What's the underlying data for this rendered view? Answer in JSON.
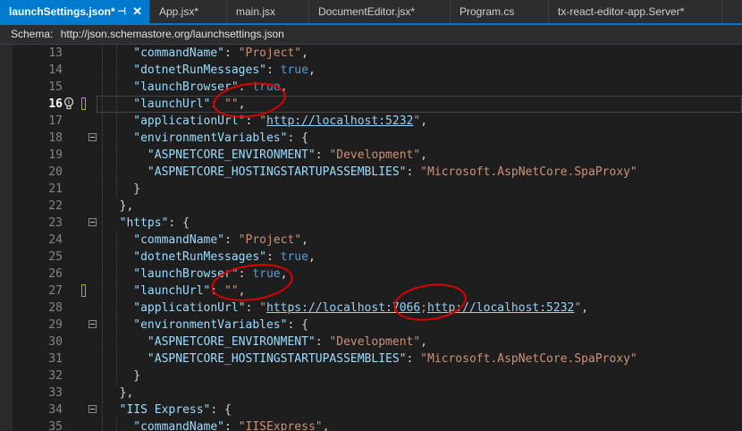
{
  "tabs": [
    {
      "label": "launchSettings.json*",
      "active": true
    },
    {
      "label": "App.jsx*"
    },
    {
      "label": "main.jsx"
    },
    {
      "label": "DocumentEditor.jsx*"
    },
    {
      "label": "Program.cs"
    },
    {
      "label": "tx-react-editor-app.Server*"
    }
  ],
  "schema": {
    "label": "Schema:",
    "url": "http://json.schemastore.org/launchsettings.json"
  },
  "editor": {
    "current_line": 16,
    "lines": [
      {
        "n": "13",
        "t": [
          [
            "k",
            "\"commandName\""
          ],
          [
            "p",
            ": "
          ],
          [
            "s",
            "\"Project\""
          ],
          [
            "p",
            ","
          ]
        ]
      },
      {
        "n": "14",
        "t": [
          [
            "k",
            "\"dotnetRunMessages\""
          ],
          [
            "p",
            ": "
          ],
          [
            "b",
            "true"
          ],
          [
            "p",
            ","
          ]
        ]
      },
      {
        "n": "15",
        "t": [
          [
            "k",
            "\"launchBrowser\""
          ],
          [
            "p",
            ": "
          ],
          [
            "b",
            "true"
          ],
          [
            "p",
            ","
          ]
        ]
      },
      {
        "n": "16",
        "t": [
          [
            "k",
            "\"launchUrl\""
          ],
          [
            "p",
            ": "
          ],
          [
            "s",
            "\"\""
          ],
          [
            "p",
            ","
          ]
        ]
      },
      {
        "n": "17",
        "t": [
          [
            "k",
            "\"applicationUrl\""
          ],
          [
            "p",
            ": "
          ],
          [
            "s",
            "\""
          ],
          [
            "u",
            "http://localhost:5232"
          ],
          [
            "s",
            "\""
          ],
          [
            "p",
            ","
          ]
        ]
      },
      {
        "n": "18",
        "t": [
          [
            "k",
            "\"environmentVariables\""
          ],
          [
            "p",
            ": {"
          ]
        ]
      },
      {
        "n": "19",
        "t": [
          [
            "p",
            "  "
          ],
          [
            "k",
            "\"ASPNETCORE_ENVIRONMENT\""
          ],
          [
            "p",
            ": "
          ],
          [
            "s",
            "\"Development\""
          ],
          [
            "p",
            ","
          ]
        ]
      },
      {
        "n": "20",
        "t": [
          [
            "p",
            "  "
          ],
          [
            "k",
            "\"ASPNETCORE_HOSTINGSTARTUPASSEMBLIES\""
          ],
          [
            "p",
            ": "
          ],
          [
            "s",
            "\"Microsoft.AspNetCore.SpaProxy\""
          ]
        ]
      },
      {
        "n": "21",
        "t": [
          [
            "p",
            "}"
          ]
        ]
      },
      {
        "n": "22",
        "t": [
          [
            "p",
            "},"
          ]
        ]
      },
      {
        "n": "23",
        "t": [
          [
            "k",
            "\"https\""
          ],
          [
            "p",
            ": {"
          ]
        ]
      },
      {
        "n": "24",
        "t": [
          [
            "k",
            "\"commandName\""
          ],
          [
            "p",
            ": "
          ],
          [
            "s",
            "\"Project\""
          ],
          [
            "p",
            ","
          ]
        ]
      },
      {
        "n": "25",
        "t": [
          [
            "k",
            "\"dotnetRunMessages\""
          ],
          [
            "p",
            ": "
          ],
          [
            "b",
            "true"
          ],
          [
            "p",
            ","
          ]
        ]
      },
      {
        "n": "26",
        "t": [
          [
            "k",
            "\"launchBrowser\""
          ],
          [
            "p",
            ": "
          ],
          [
            "b",
            "true"
          ],
          [
            "p",
            ","
          ]
        ]
      },
      {
        "n": "27",
        "t": [
          [
            "k",
            "\"launchUrl\""
          ],
          [
            "p",
            ": "
          ],
          [
            "s",
            "\"\""
          ],
          [
            "p",
            ","
          ]
        ]
      },
      {
        "n": "28",
        "t": [
          [
            "k",
            "\"applicationUrl\""
          ],
          [
            "p",
            ": "
          ],
          [
            "s",
            "\""
          ],
          [
            "u",
            "https://localhost:7066"
          ],
          [
            "s",
            ";"
          ],
          [
            "u",
            "http://localhost:5232"
          ],
          [
            "s",
            "\""
          ],
          [
            "p",
            ","
          ]
        ]
      },
      {
        "n": "29",
        "t": [
          [
            "k",
            "\"environmentVariables\""
          ],
          [
            "p",
            ": {"
          ]
        ]
      },
      {
        "n": "30",
        "t": [
          [
            "p",
            "  "
          ],
          [
            "k",
            "\"ASPNETCORE_ENVIRONMENT\""
          ],
          [
            "p",
            ": "
          ],
          [
            "s",
            "\"Development\""
          ],
          [
            "p",
            ","
          ]
        ]
      },
      {
        "n": "31",
        "t": [
          [
            "p",
            "  "
          ],
          [
            "k",
            "\"ASPNETCORE_HOSTINGSTARTUPASSEMBLIES\""
          ],
          [
            "p",
            ": "
          ],
          [
            "s",
            "\"Microsoft.AspNetCore.SpaProxy\""
          ]
        ]
      },
      {
        "n": "32",
        "t": [
          [
            "p",
            "}"
          ]
        ]
      },
      {
        "n": "33",
        "t": [
          [
            "p",
            "},"
          ]
        ]
      },
      {
        "n": "34",
        "t": [
          [
            "k",
            "\"IIS Express\""
          ],
          [
            "p",
            ": {"
          ]
        ]
      },
      {
        "n": "35",
        "t": [
          [
            "k",
            "\"commandName\""
          ],
          [
            "p",
            ": "
          ],
          [
            "s",
            "\"IISExpress\""
          ],
          [
            "p",
            ","
          ]
        ]
      }
    ]
  },
  "colors": {
    "accent": "#007acc",
    "annotation": "#e00000",
    "change_marker": "#c9a800"
  },
  "icons": {
    "lightbulb": "lightbulb-icon",
    "fold": "fold-toggle-icon",
    "pin": "pin-icon",
    "close": "close-icon"
  }
}
